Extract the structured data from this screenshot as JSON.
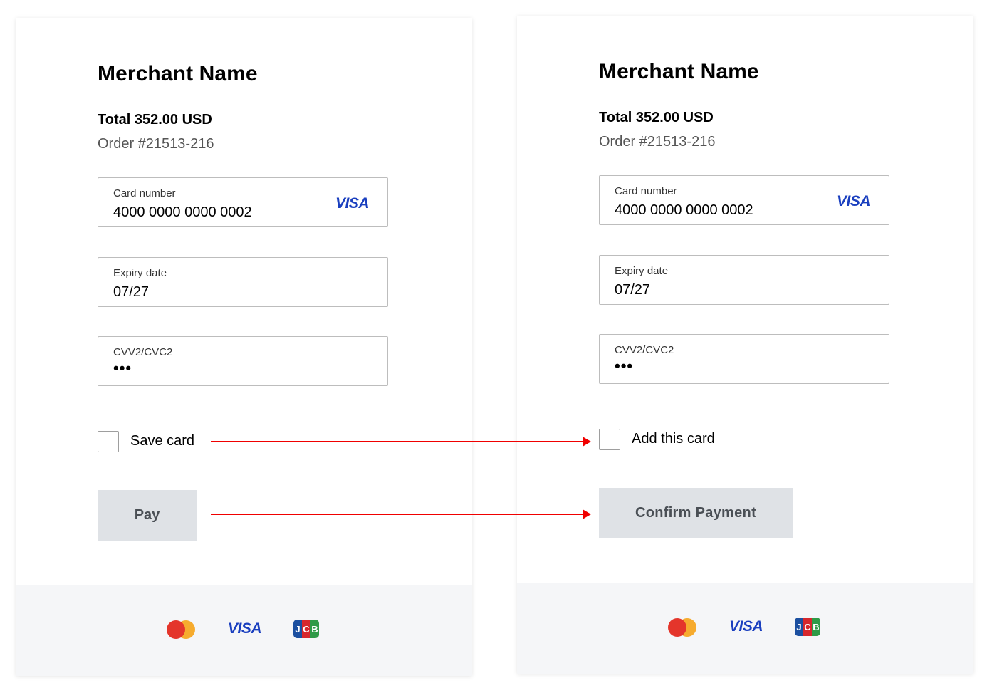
{
  "left_form": {
    "merchant_name": "Merchant Name",
    "total": "Total 352.00 USD",
    "order": "Order #21513-216",
    "card_number_label": "Card number",
    "card_number_value": "4000 0000 0000 0002",
    "card_brand": "VISA",
    "expiry_label": "Expiry date",
    "expiry_value": "07/27",
    "cvv_label": "CVV2/CVC2",
    "cvv_value": "•••",
    "checkbox_label": "Save card",
    "checkbox_checked": false,
    "button_label": "Pay"
  },
  "right_form": {
    "merchant_name": "Merchant Name",
    "total": "Total 352.00 USD",
    "order": "Order #21513-216",
    "card_number_label": "Card number",
    "card_number_value": "4000 0000 0000 0002",
    "card_brand": "VISA",
    "expiry_label": "Expiry date",
    "expiry_value": "07/27",
    "cvv_label": "CVV2/CVC2",
    "cvv_value": "•••",
    "checkbox_label": "Add this card",
    "checkbox_checked": false,
    "button_label": "Confirm Payment"
  },
  "footer_brands": {
    "mastercard_icon": "mastercard-icon",
    "visa": "VISA",
    "jcb_letters": [
      "J",
      "C",
      "B"
    ]
  },
  "colors": {
    "visa_blue": "#1a3fbf",
    "button_bg": "#dfe2e6",
    "button_text": "#4a4f55",
    "arrow_red": "#f00000",
    "footer_bg": "#f5f6f8"
  },
  "annotations": {
    "arrows": [
      "checkbox-label-change",
      "button-label-change"
    ]
  }
}
